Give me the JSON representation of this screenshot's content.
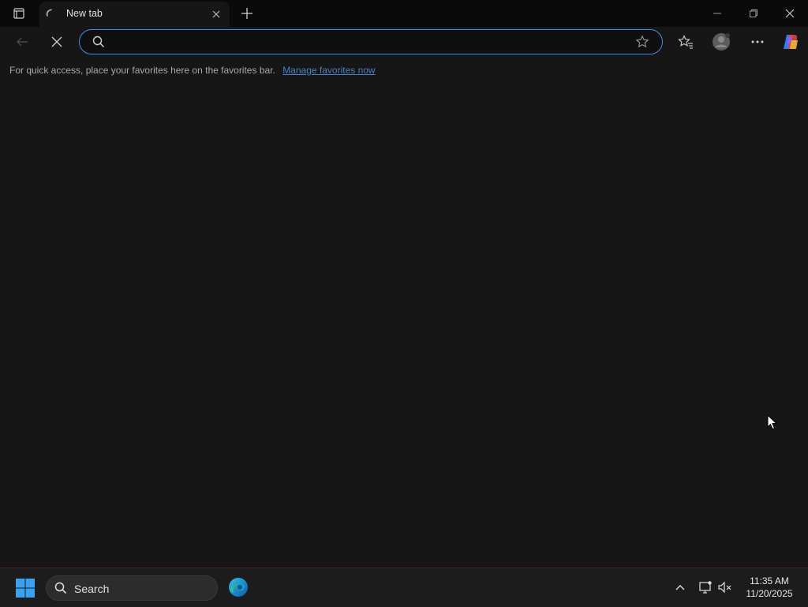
{
  "browser": {
    "tab": {
      "title": "New tab",
      "close_icon": "close-icon",
      "loading_icon": "spinner-icon"
    },
    "window_controls": [
      "minimize-icon",
      "restore-icon",
      "close-icon"
    ],
    "address_bar": {
      "value": "",
      "placeholder": ""
    },
    "favorites_bar": {
      "message": "For quick access, place your favorites here on the favorites bar.",
      "link": "Manage favorites now"
    }
  },
  "taskbar": {
    "search_label": "Search",
    "clock": {
      "time": "11:35 AM",
      "date": "11/20/2025"
    }
  },
  "colors": {
    "accent": "#4a86e8",
    "background": "#161616",
    "titlebar": "#0a0a0a",
    "taskbar": "#1c1c1c",
    "link": "#4a80c0"
  }
}
